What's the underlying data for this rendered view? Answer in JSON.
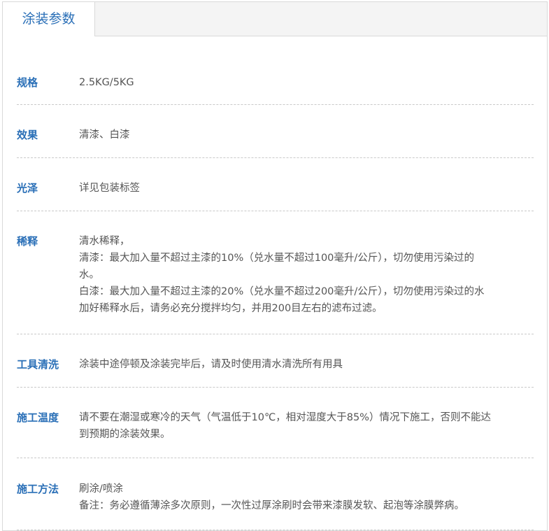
{
  "tabs": [
    {
      "label": "涂装参数"
    }
  ],
  "params": [
    {
      "label": "规格",
      "value": "2.5KG/5KG"
    },
    {
      "label": "效果",
      "value": "清漆、白漆"
    },
    {
      "label": "光泽",
      "value": "详见包装标签"
    },
    {
      "label": "稀释",
      "value": "清水稀释，\n清漆：最大加入量不超过主漆的10%（兑水量不超过100毫升/公斤），切勿使用污染过的\n水。\n白漆：最大加入量不超过主漆的20%（兑水量不超过200毫升/公斤），切勿使用污染过的水\n加好稀释水后，请务必充分搅拌均匀，并用200目左右的滤布过滤。"
    },
    {
      "label": "工具清洗",
      "value": "涂装中途停顿及涂装完毕后，请及时使用清水清洗所有用具"
    },
    {
      "label": "施工温度",
      "value": "请不要在潮湿或寒冷的天气（气温低于10℃，相对湿度大于85%）情况下施工，否则不能达\n到预期的涂装效果。"
    },
    {
      "label": "施工方法",
      "value": "刷涂/喷涂\n备注：务必遵循薄涂多次原则，一次性过厚涂刷时会带来漆膜发软、起泡等涂膜弊病。"
    }
  ]
}
